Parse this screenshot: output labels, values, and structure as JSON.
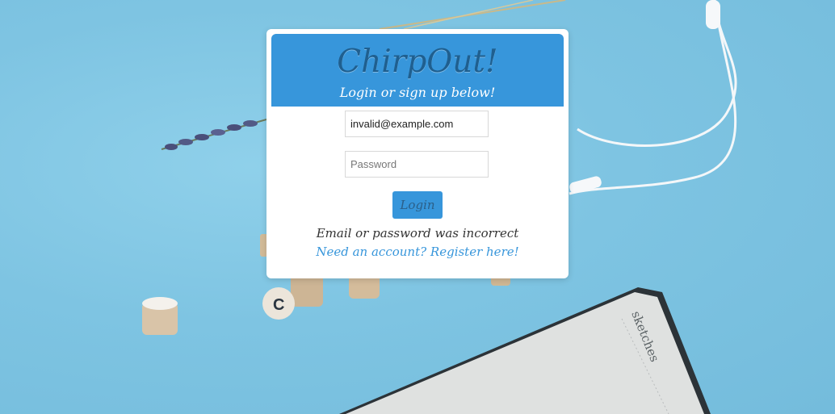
{
  "app": {
    "title": "ChirpOut!",
    "subtitle": "Login or sign up below!"
  },
  "form": {
    "email_value": "invalid@example.com",
    "password_placeholder": "Password",
    "login_label": "Login"
  },
  "messages": {
    "error": "Email or password was incorrect",
    "register_link": "Need an account? Register here!"
  },
  "background": {
    "notebook_label": "sketches"
  },
  "colors": {
    "accent": "#3796db",
    "background": "#7ec4e2",
    "card": "#ffffff"
  }
}
